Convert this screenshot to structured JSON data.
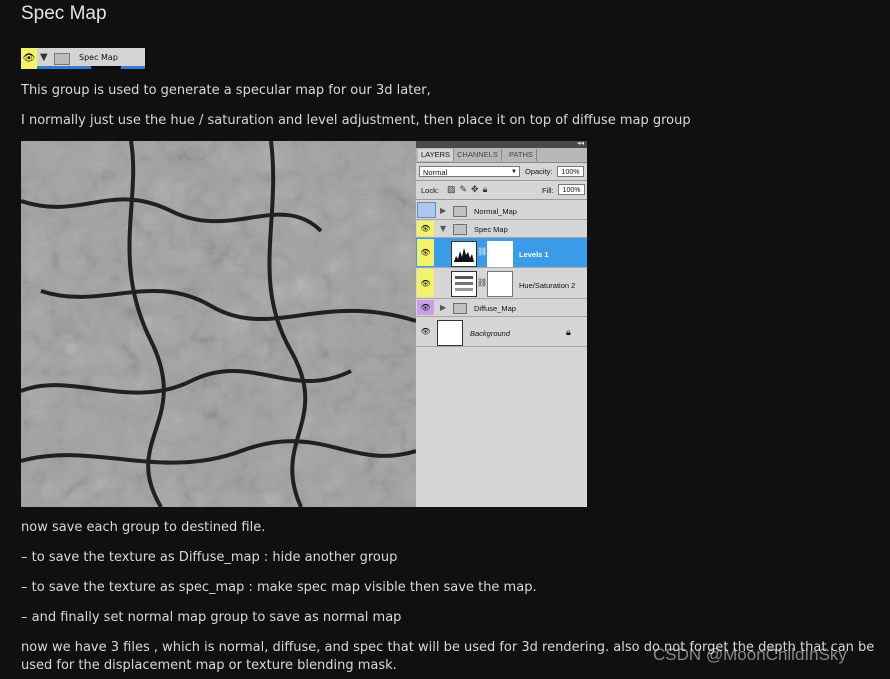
{
  "title": "Spec Map",
  "strip": {
    "group_label": "Spec Map",
    "eye_color": "#f3f36a",
    "selection_color": "#2a7fd8"
  },
  "paragraphs": {
    "p1": "This group is used to generate a specular map for our 3d later,",
    "p2": "I normally just use the hue / saturation and level adjustment,  then place it on top of diffuse map group",
    "p3": "now save each group to destined file.",
    "p4": "– to save the texture as Diffuse_map : hide another group",
    "p5": "– to save the texture as  spec_map : make spec map visible then save the map.",
    "p6": "– and finally set normal map group to save as normal map",
    "p7a": "now we have 3 files , which is normal, diffuse, and  spec that will be used for 3d rendering. also do not forget the depth that can be",
    "p7b": "used for the displacement map or texture blending mask."
  },
  "image": {
    "icon": "rock-texture-image"
  },
  "layers_panel": {
    "tabs": [
      "LAYERS",
      "CHANNELS",
      "PATHS"
    ],
    "blend_mode": "Normal",
    "opacity_label": "Opacity:",
    "opacity_value": "100%",
    "lock_label": "Lock:",
    "fill_label": "Fill:",
    "fill_value": "100%",
    "layers": [
      {
        "name": "Normal_Map",
        "type": "group",
        "expanded": false,
        "tag_color": "#a8c8f0"
      },
      {
        "name": "Spec Map",
        "type": "group",
        "expanded": true,
        "tag_color": "#f3f36a"
      },
      {
        "name": "Levels 1",
        "type": "adjustment",
        "selected": true,
        "tag_color": "#f3f36a"
      },
      {
        "name": "Hue/Saturation 2",
        "type": "adjustment",
        "tag_color": "#f3f36a"
      },
      {
        "name": "Diffuse_Map",
        "type": "group",
        "expanded": false,
        "tag_color": "#c8a0e8"
      },
      {
        "name": "Background",
        "type": "layer",
        "locked": true
      }
    ],
    "selection_color": "#3a9be8"
  },
  "watermark": "CSDN @MoonChildInSky"
}
